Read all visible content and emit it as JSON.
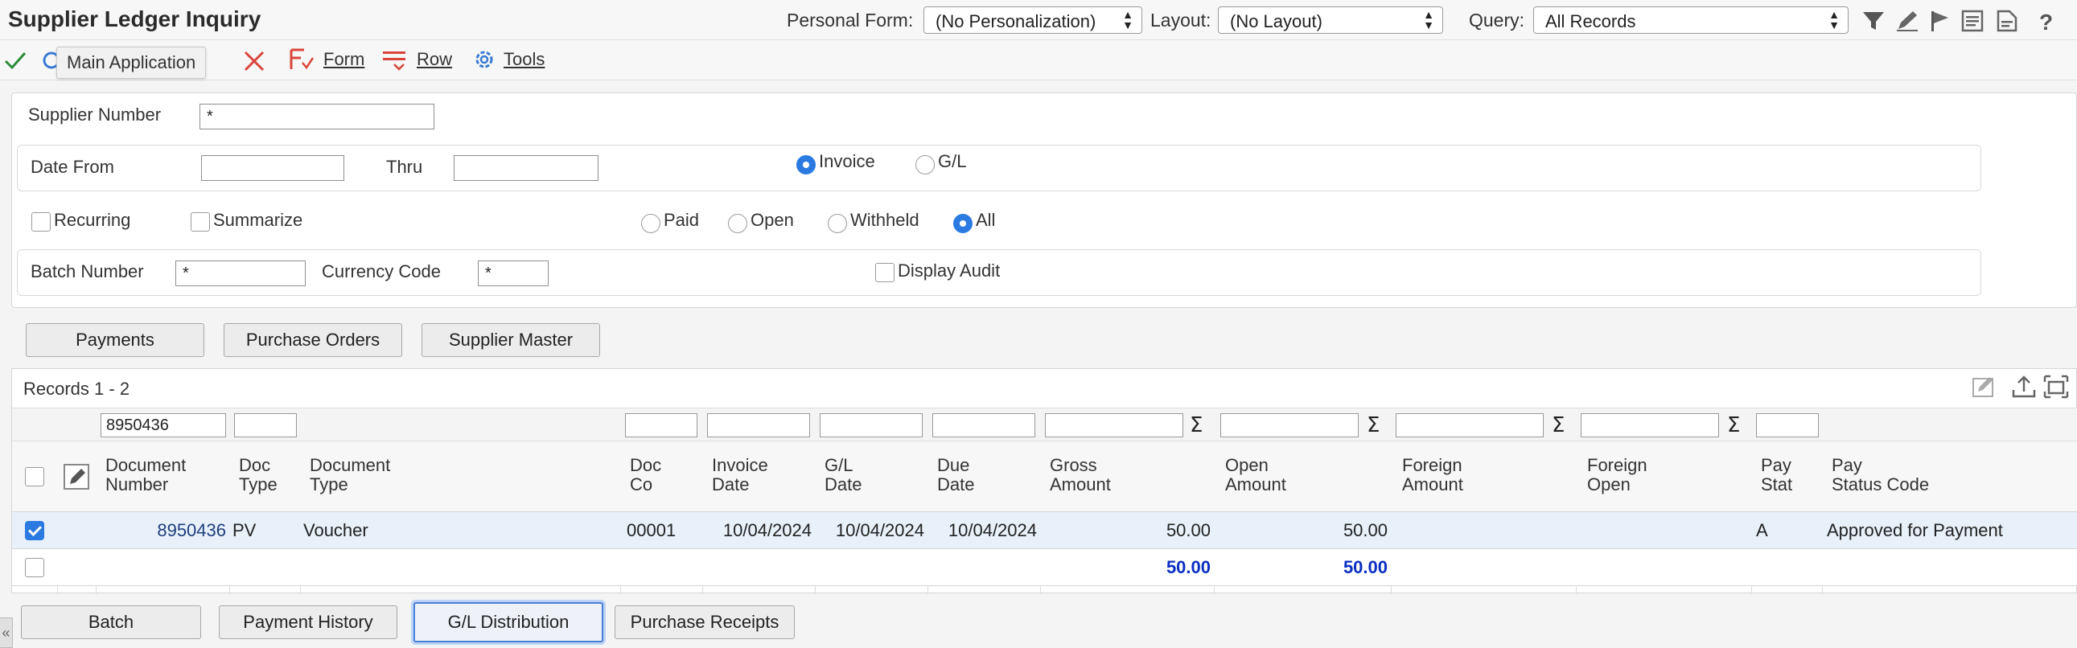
{
  "header": {
    "title": "Supplier Ledger Inquiry",
    "personal_form_label": "Personal Form:",
    "personal_form_value": "(No Personalization)",
    "layout_label": "Layout:",
    "layout_value": "(No Layout)",
    "query_label": "Query:",
    "query_value": "All Records"
  },
  "toolbar": {
    "tooltip": "Main Application",
    "form_label": "Form",
    "row_label": "Row",
    "tools_label": "Tools"
  },
  "criteria": {
    "supplier_number_label": "Supplier Number",
    "supplier_number_value": "*",
    "date_from_label": "Date From",
    "date_from_value": "",
    "thru_label": "Thru",
    "thru_value": "",
    "invoice_label": "Invoice",
    "gl_label": "G/L",
    "recurring_label": "Recurring",
    "summarize_label": "Summarize",
    "paid_label": "Paid",
    "open_label": "Open",
    "withheld_label": "Withheld",
    "all_label": "All",
    "batch_number_label": "Batch Number",
    "batch_number_value": "*",
    "currency_code_label": "Currency Code",
    "currency_code_value": "*",
    "display_audit_label": "Display Audit"
  },
  "top_buttons": {
    "payments": "Payments",
    "purchase_orders": "Purchase Orders",
    "supplier_master": "Supplier Master"
  },
  "grid": {
    "records_label": "Records 1 - 2",
    "filter_document_number": "8950436",
    "headers": {
      "document_number": [
        "Document",
        "Number"
      ],
      "doc_type": [
        "Doc",
        "Type"
      ],
      "document_type": [
        "Document",
        "Type"
      ],
      "doc_co": [
        "Doc",
        "Co"
      ],
      "invoice_date": [
        "Invoice",
        "Date"
      ],
      "gl_date": [
        "G/L",
        "Date"
      ],
      "due_date": [
        "Due",
        "Date"
      ],
      "gross_amount": [
        "Gross",
        "Amount"
      ],
      "open_amount": [
        "Open",
        "Amount"
      ],
      "foreign_amount": [
        "Foreign",
        "Amount"
      ],
      "foreign_open": [
        "Foreign",
        "Open"
      ],
      "pay_stat": [
        "Pay",
        "Stat"
      ],
      "pay_status_code": [
        "Pay",
        "Status Code"
      ]
    },
    "row": {
      "document_number": "8950436",
      "doc_type": "PV",
      "document_type": "Voucher",
      "doc_co": "00001",
      "invoice_date": "10/04/2024",
      "gl_date": "10/04/2024",
      "due_date": "10/04/2024",
      "gross_amount": "50.00",
      "open_amount": "50.00",
      "pay_stat": "A",
      "pay_status_code": "Approved for Payment"
    },
    "totals": {
      "gross_amount": "50.00",
      "open_amount": "50.00"
    }
  },
  "bottom_buttons": {
    "batch": "Batch",
    "payment_history": "Payment History",
    "gl_distribution": "G/L Distribution",
    "purchase_receipts": "Purchase Receipts"
  },
  "colors": {
    "accent": "#2a7ae2",
    "total_text": "#0a2fc2",
    "selected_row": "#e8f0fa"
  }
}
